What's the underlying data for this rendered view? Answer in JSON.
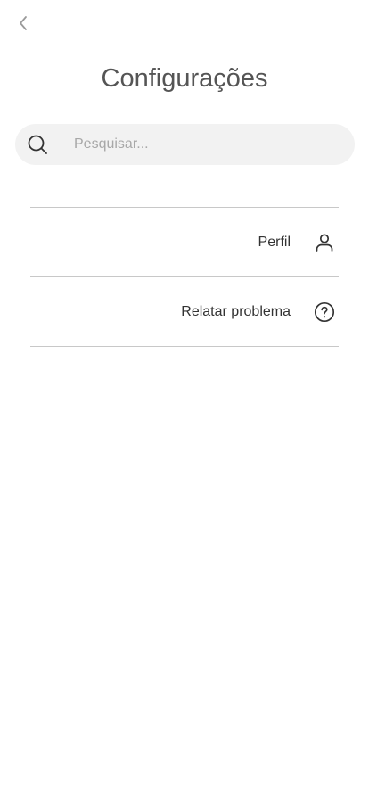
{
  "header": {
    "back_icon": "chevron-left-icon",
    "title": "Configurações"
  },
  "search": {
    "icon": "search-icon",
    "placeholder": "Pesquisar...",
    "value": ""
  },
  "menu": {
    "items": [
      {
        "label": "Perfil",
        "icon": "user-icon"
      },
      {
        "label": "Relatar problema",
        "icon": "help-circle-icon"
      }
    ]
  },
  "colors": {
    "title": "#555555",
    "search_background": "#f2f2f2",
    "placeholder": "#a8a8a8",
    "divider": "#c8c8c8",
    "item_text": "#333333"
  }
}
